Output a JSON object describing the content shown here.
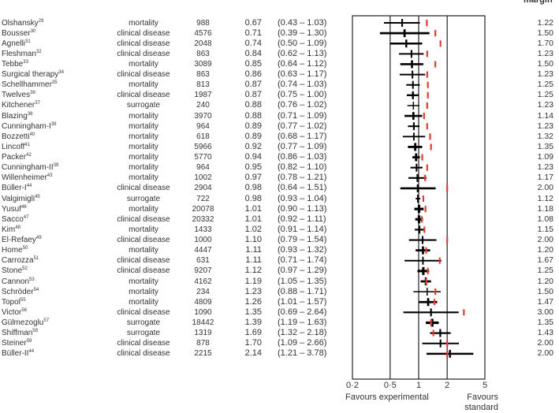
{
  "chart_data": {
    "type": "forest",
    "x_scale": "log",
    "xlim": [
      0.2,
      5
    ],
    "x_ticks": [
      "0·2",
      "0·5",
      "1",
      "2",
      "5"
    ],
    "x_tick_values": [
      0.2,
      0.5,
      1,
      2,
      5
    ],
    "reference_lines": [
      0.5,
      1,
      2
    ],
    "left_label": "Favours experimental",
    "right_label": "Favours standard",
    "margin_header": "margin",
    "colors": {
      "estimate": "#000000",
      "margin_marker": "#e8392a"
    },
    "trials": [
      {
        "name": "Olshansky",
        "ref": "29",
        "outcome": "mortality",
        "n": "988",
        "or": "0.67",
        "ci": "(0.43 – 1.03)",
        "lo": 0.43,
        "hi": 1.03,
        "margin": "1.22"
      },
      {
        "name": "Bousser",
        "ref": "30",
        "outcome": "clinical disease",
        "n": "4576",
        "or": "0.71",
        "ci": "(0.39 – 1.30)",
        "lo": 0.39,
        "hi": 1.3,
        "margin": "1.50"
      },
      {
        "name": "Agnelli",
        "ref": "31",
        "outcome": "clinical disease",
        "n": "2048",
        "or": "0.74",
        "ci": "(0.50 – 1.09)",
        "lo": 0.5,
        "hi": 1.09,
        "margin": "1.70"
      },
      {
        "name": "Fleshman",
        "ref": "32",
        "outcome": "clinical disease",
        "n": "863",
        "or": "0.84",
        "ci": "(0.62 – 1.13)",
        "lo": 0.62,
        "hi": 1.13,
        "margin": "1.23"
      },
      {
        "name": "Tebbe",
        "ref": "33",
        "outcome": "mortality",
        "n": "3089",
        "or": "0.85",
        "ci": "(0.64 – 1.12)",
        "lo": 0.64,
        "hi": 1.12,
        "margin": "1.50"
      },
      {
        "name": "Surgical therapy",
        "ref": "34",
        "outcome": "clinical disease",
        "n": "863",
        "or": "0.86",
        "ci": "(0.63 – 1.17)",
        "lo": 0.63,
        "hi": 1.17,
        "margin": "1.23"
      },
      {
        "name": "Schellhammer",
        "ref": "35",
        "outcome": "mortality",
        "n": "813",
        "or": "0.87",
        "ci": "(0.74 – 1.03)",
        "lo": 0.74,
        "hi": 1.03,
        "margin": "1.25"
      },
      {
        "name": "Twelves",
        "ref": "36",
        "outcome": "clinical disease",
        "n": "1987",
        "or": "0.87",
        "ci": "(0.75 – 1.00)",
        "lo": 0.75,
        "hi": 1.0,
        "margin": "1.25"
      },
      {
        "name": "Kitchener",
        "ref": "37",
        "outcome": "surrogate",
        "n": "240",
        "or": "0.88",
        "ci": "(0.76 – 1.02)",
        "lo": 0.76,
        "hi": 1.02,
        "margin": "1.23"
      },
      {
        "name": "Blazing",
        "ref": "38",
        "outcome": "mortality",
        "n": "3970",
        "or": "0.88",
        "ci": "(0.71 – 1.09)",
        "lo": 0.71,
        "hi": 1.09,
        "margin": "1.14"
      },
      {
        "name": "Cunningham-I",
        "ref": "39",
        "outcome": "mortality",
        "n": "964",
        "or": "0.89",
        "ci": "(0.77 – 1.02)",
        "lo": 0.77,
        "hi": 1.02,
        "margin": "1.23"
      },
      {
        "name": "Bozzetti",
        "ref": "40",
        "outcome": "mortality",
        "n": "618",
        "or": "0.89",
        "ci": "(0.68 – 1.17)",
        "lo": 0.68,
        "hi": 1.17,
        "margin": "1.32"
      },
      {
        "name": "Lincoff",
        "ref": "41",
        "outcome": "mortality",
        "n": "5966",
        "or": "0.92",
        "ci": "(0.77 – 1.09)",
        "lo": 0.77,
        "hi": 1.09,
        "margin": "1.35"
      },
      {
        "name": "Packer",
        "ref": "42",
        "outcome": "mortality",
        "n": "5770",
        "or": "0.94",
        "ci": "(0.86 – 1.03)",
        "lo": 0.86,
        "hi": 1.03,
        "margin": "1.09"
      },
      {
        "name": "Cunningham-II",
        "ref": "39",
        "outcome": "mortality",
        "n": "964",
        "or": "0.95",
        "ci": "(0.82 – 1.10)",
        "lo": 0.82,
        "hi": 1.1,
        "margin": "1.23"
      },
      {
        "name": "Willenheimer",
        "ref": "43",
        "outcome": "mortality",
        "n": "1002",
        "or": "0.97",
        "ci": "(0.78 – 1.21)",
        "lo": 0.78,
        "hi": 1.21,
        "margin": "1.17"
      },
      {
        "name": "Büller-I",
        "ref": "44",
        "outcome": "clinical disease",
        "n": "2904",
        "or": "0.98",
        "ci": "(0.64 – 1.51)",
        "lo": 0.64,
        "hi": 1.51,
        "margin": "2.00"
      },
      {
        "name": "Valgimigli",
        "ref": "45",
        "outcome": "surrogate",
        "n": "722",
        "or": "0.98",
        "ci": "(0.93 – 1.04)",
        "lo": 0.93,
        "hi": 1.04,
        "margin": "1.12"
      },
      {
        "name": "Yusuf",
        "ref": "46",
        "outcome": "mortality",
        "n": "20078",
        "or": "1.01",
        "ci": "(0.90 – 1.13)",
        "lo": 0.9,
        "hi": 1.13,
        "margin": "1.18"
      },
      {
        "name": "Sacco",
        "ref": "47",
        "outcome": "clinical disease",
        "n": "20332",
        "or": "1.01",
        "ci": "(0.92 – 1.11)",
        "lo": 0.92,
        "hi": 1.11,
        "margin": "1.08"
      },
      {
        "name": "Kim",
        "ref": "48",
        "outcome": "mortality",
        "n": "1433",
        "or": "1.02",
        "ci": "(0.91 – 1.14)",
        "lo": 0.91,
        "hi": 1.14,
        "margin": "1.15"
      },
      {
        "name": "El-Refaey",
        "ref": "49",
        "outcome": "clinical disease",
        "n": "1000",
        "or": "1.10",
        "ci": "(0.79 – 1.54)",
        "lo": 0.79,
        "hi": 1.54,
        "margin": "2.00"
      },
      {
        "name": "Home",
        "ref": "50",
        "outcome": "mortality",
        "n": "4447",
        "or": "1.11",
        "ci": "(0.93 – 1.32)",
        "lo": 0.93,
        "hi": 1.32,
        "margin": "1.20"
      },
      {
        "name": "Carrozza",
        "ref": "51",
        "outcome": "clinical disease",
        "n": "631",
        "or": "1.11",
        "ci": "(0.71 – 1.74)",
        "lo": 0.71,
        "hi": 1.74,
        "margin": "1.67"
      },
      {
        "name": "Stone",
        "ref": "52",
        "outcome": "clinical disease",
        "n": "9207",
        "or": "1.12",
        "ci": "(0.97 – 1.29)",
        "lo": 0.97,
        "hi": 1.29,
        "margin": "1.25"
      },
      {
        "name": "Cannon",
        "ref": "53",
        "outcome": "mortality",
        "n": "4162",
        "or": "1.19",
        "ci": "(1.05 – 1.35)",
        "lo": 1.05,
        "hi": 1.35,
        "margin": "1.20"
      },
      {
        "name": "Schröder",
        "ref": "54",
        "outcome": "mortality",
        "n": "234",
        "or": "1.23",
        "ci": "(0.88 – 1.71)",
        "lo": 0.88,
        "hi": 1.71,
        "margin": "1.50"
      },
      {
        "name": "Topol",
        "ref": "55",
        "outcome": "mortality",
        "n": "4809",
        "or": "1.26",
        "ci": "(1.01 – 1.57)",
        "lo": 1.01,
        "hi": 1.57,
        "margin": "1.47"
      },
      {
        "name": "Victor",
        "ref": "56",
        "outcome": "clinical disease",
        "n": "1090",
        "or": "1.35",
        "ci": "(0.69 – 2.64)",
        "lo": 0.69,
        "hi": 2.64,
        "margin": "3.00"
      },
      {
        "name": "Gülmezoglu",
        "ref": "57",
        "outcome": "surrogate",
        "n": "18442",
        "or": "1.39",
        "ci": "(1.19 – 1.63)",
        "lo": 1.19,
        "hi": 1.63,
        "margin": "1.35"
      },
      {
        "name": "Shiffman",
        "ref": "58",
        "outcome": "surrogate",
        "n": "1319",
        "or": "1.69",
        "ci": "(1.32 – 2.18)",
        "lo": 1.32,
        "hi": 2.18,
        "margin": "1.43"
      },
      {
        "name": "Steiner",
        "ref": "59",
        "outcome": "clinical disease",
        "n": "878",
        "or": "1.70",
        "ci": "(1.09 – 2.66)",
        "lo": 1.09,
        "hi": 2.66,
        "margin": "2.00"
      },
      {
        "name": "Büller-II",
        "ref": "44",
        "outcome": "clinical disease",
        "n": "2215",
        "or": "2.14",
        "ci": "(1.21 – 3.78)",
        "lo": 1.21,
        "hi": 3.78,
        "margin": "2.00"
      }
    ]
  }
}
